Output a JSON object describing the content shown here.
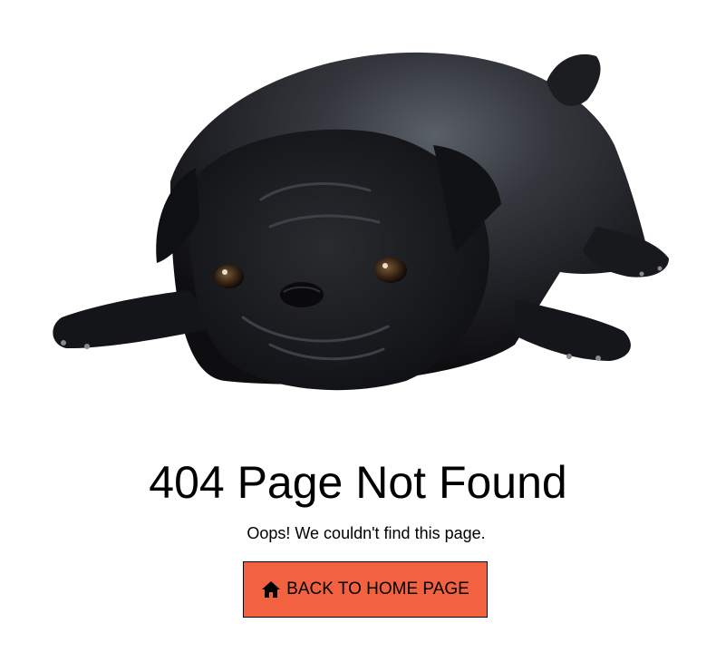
{
  "hero": {
    "subject": "black pug lying down",
    "coat_color": "#1a1b1e"
  },
  "error": {
    "title": "404 Page Not Found",
    "message": "Oops! We couldn't find this page."
  },
  "home_button": {
    "label": "BACK TO HOME PAGE",
    "icon": "home-icon",
    "background": "#f26140"
  }
}
